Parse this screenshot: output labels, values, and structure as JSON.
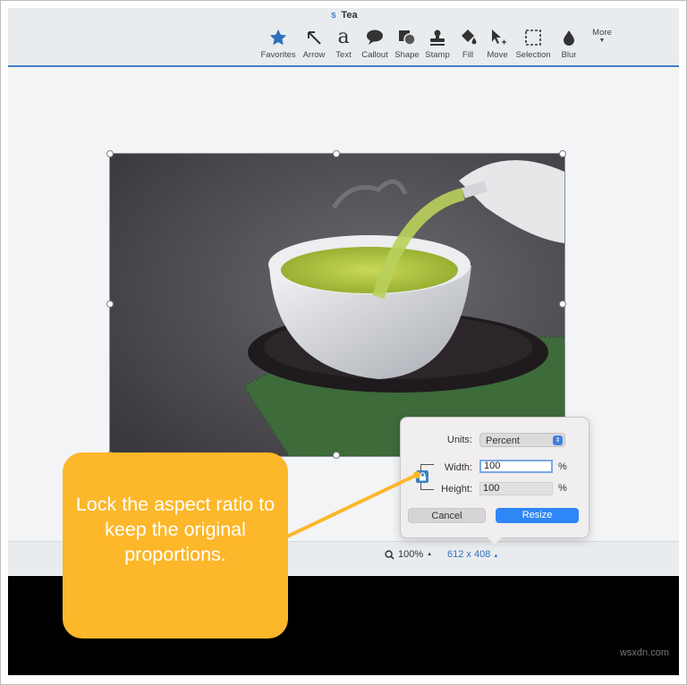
{
  "window": {
    "title": "Tea",
    "app_badge": "S"
  },
  "toolbar": {
    "items": [
      {
        "label": "Favorites",
        "icon": "star-icon"
      },
      {
        "label": "Arrow",
        "icon": "arrow-icon"
      },
      {
        "label": "Text",
        "icon": "text-a-icon"
      },
      {
        "label": "Callout",
        "icon": "speech-bubble-icon"
      },
      {
        "label": "Shape",
        "icon": "shape-icon"
      },
      {
        "label": "Stamp",
        "icon": "stamp-icon"
      },
      {
        "label": "Fill",
        "icon": "paint-bucket-icon"
      },
      {
        "label": "Move",
        "icon": "cursor-move-icon"
      },
      {
        "label": "Selection",
        "icon": "dashed-square-icon"
      },
      {
        "label": "Blur",
        "icon": "water-drop-icon"
      }
    ],
    "more_label": "More"
  },
  "status": {
    "zoom": "100%",
    "dimensions": "612 x 408"
  },
  "resize_popover": {
    "units_label": "Units:",
    "units_value": "Percent",
    "width_label": "Width:",
    "width_value": "100",
    "height_label": "Height:",
    "height_value": "100",
    "percent_sign": "%",
    "cancel_label": "Cancel",
    "resize_label": "Resize"
  },
  "callout": {
    "text": "Lock the aspect ratio to keep the original proportions."
  },
  "watermark": "wsxdn.com",
  "colors": {
    "accent": "#2f86f6",
    "callout": "#fcb72a",
    "toolbar_icon": "#2f6fba"
  }
}
